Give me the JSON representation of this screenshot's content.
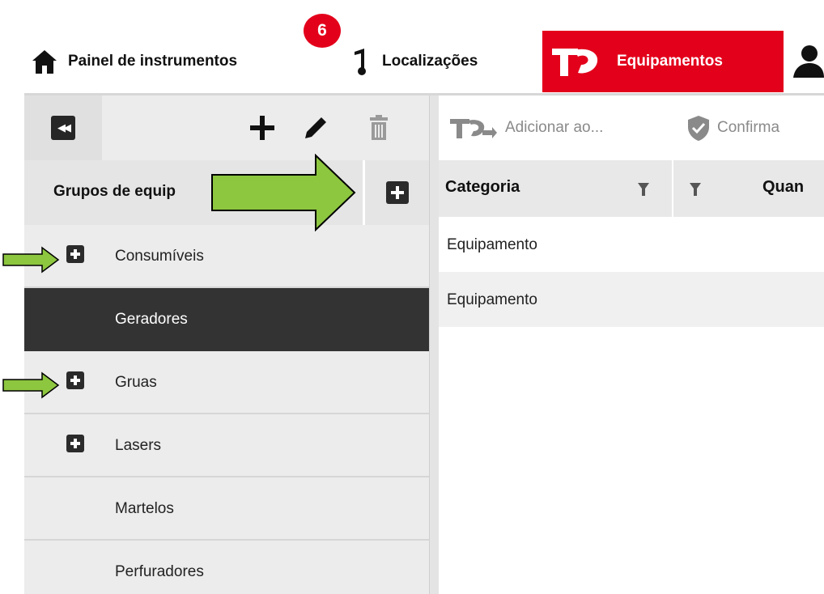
{
  "nav": {
    "items": [
      {
        "label": "Painel de instrumentos",
        "icon": "home-icon"
      },
      {
        "label": "Localizações",
        "icon": "location-pin-icon"
      },
      {
        "label": "Equipamentos",
        "icon": "equipment-icon",
        "active": true
      }
    ],
    "notification_count": "6"
  },
  "left_panel": {
    "group_title": "Grupos de equip",
    "groups": [
      {
        "label": "Consumíveis",
        "expandable": true,
        "selected": false
      },
      {
        "label": "Geradores",
        "expandable": false,
        "selected": true
      },
      {
        "label": "Gruas",
        "expandable": true,
        "selected": false
      },
      {
        "label": "Lasers",
        "expandable": true,
        "selected": false
      },
      {
        "label": "Martelos",
        "expandable": false,
        "selected": false
      },
      {
        "label": "Perfuradores",
        "expandable": false,
        "selected": false
      }
    ]
  },
  "right_panel": {
    "toolbar": {
      "add_label": "Adicionar ao...",
      "confirm_label": "Confirma"
    },
    "columns": {
      "category": "Categoria",
      "quantity": "Quan"
    },
    "rows": [
      {
        "category": "Equipamento"
      },
      {
        "category": "Equipamento"
      }
    ]
  },
  "colors": {
    "accent": "#e3001b",
    "selected_row": "#333333",
    "annotation_arrow": "#8dc63f"
  }
}
